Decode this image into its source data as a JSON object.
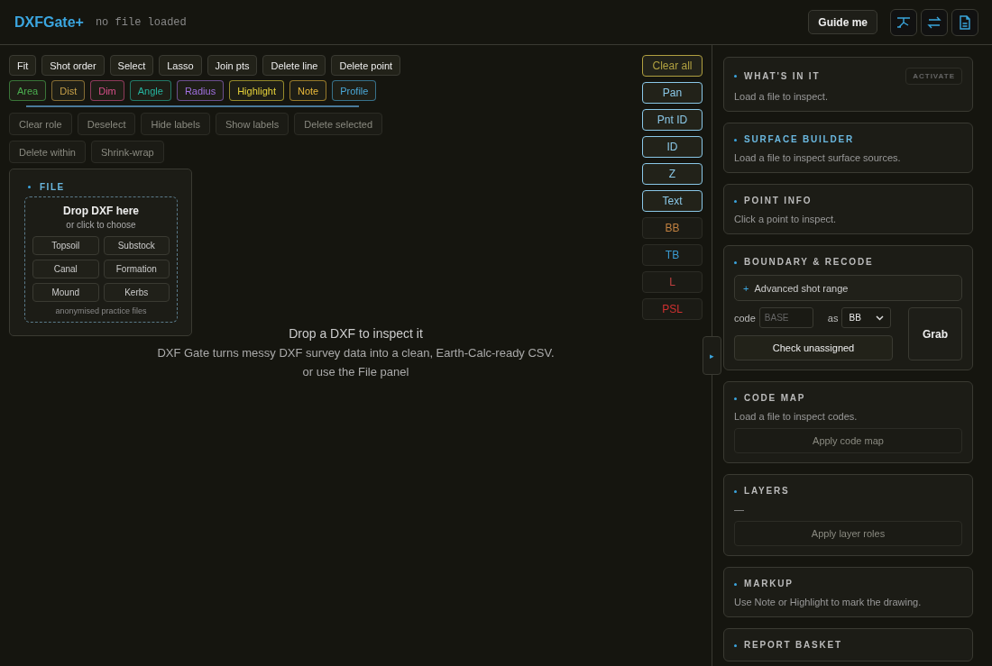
{
  "header": {
    "title": "DXFGate+",
    "file_status": "no file loaded",
    "guide_button": "Guide me"
  },
  "toolbar": {
    "tools": [
      {
        "label": "Fit"
      },
      {
        "label": "Shot order"
      },
      {
        "label": "Select"
      },
      {
        "label": "Lasso"
      },
      {
        "label": "Join pts"
      },
      {
        "label": "Delete line"
      },
      {
        "label": "Delete point"
      }
    ],
    "measure_tools": [
      {
        "label": "Area",
        "color": "#4caf50"
      },
      {
        "label": "Dist",
        "color": "#c9a24a"
      },
      {
        "label": "Dim",
        "color": "#d94f8a"
      },
      {
        "label": "Angle",
        "color": "#26b5a0"
      },
      {
        "label": "Radius",
        "color": "#a070e0"
      },
      {
        "label": "Highlight",
        "color": "#e6d23a"
      },
      {
        "label": "Note",
        "color": "#e8b83a"
      },
      {
        "label": "Profile",
        "color": "#4aa8d8"
      }
    ],
    "selection_tools": [
      {
        "label": "Clear role",
        "disabled": true
      },
      {
        "label": "Deselect",
        "disabled": true
      },
      {
        "label": "Hide labels",
        "disabled": true
      },
      {
        "label": "Show labels",
        "disabled": true
      },
      {
        "label": "Delete selected",
        "disabled": true
      },
      {
        "label": "Delete within",
        "disabled": true
      },
      {
        "label": "Shrink-wrap",
        "disabled": true
      }
    ]
  },
  "file_panel": {
    "title": "FILE",
    "drop_title": "Drop DXF here",
    "drop_hint": "or click to choose",
    "samples": [
      "Topsoil",
      "Substock",
      "Canal",
      "Formation",
      "Mound",
      "Kerbs"
    ],
    "samples_note": "anonymised practice files"
  },
  "canvas": {
    "headline": "Drop a DXF to inspect it",
    "description": "DXF Gate turns messy DXF survey data into a clean, Earth-Calc-ready CSV.",
    "hint": "or use the File panel"
  },
  "side_buttons": [
    {
      "label": "Clear all",
      "color": "#b0a040",
      "disabled": false
    },
    {
      "label": "Pan",
      "color": "#8ac8e8",
      "disabled": false
    },
    {
      "label": "Pnt ID",
      "color": "#8ac8e8",
      "disabled": false
    },
    {
      "label": "ID",
      "color": "#8ac8e8",
      "disabled": false
    },
    {
      "label": "Z",
      "color": "#8ac8e8",
      "disabled": false
    },
    {
      "label": "Text",
      "color": "#8ac8e8",
      "disabled": false
    },
    {
      "label": "BB",
      "color": "#c08040",
      "disabled": true
    },
    {
      "label": "TB",
      "color": "#3a9ad0",
      "disabled": true
    },
    {
      "label": "L",
      "color": "#c04040",
      "disabled": true
    },
    {
      "label": "PSL",
      "color": "#d03030",
      "disabled": true
    }
  ],
  "panel_toggle": "▸",
  "sections": [
    {
      "kind": "text",
      "title": "WHAT'S IN IT",
      "highlighted": false,
      "badge": "ACTIVATE",
      "text": "Load a file to inspect."
    },
    {
      "kind": "text",
      "title": "SURFACE BUILDER",
      "highlighted": true,
      "text": "Load a file to inspect surface sources."
    },
    {
      "kind": "text",
      "title": "POINT INFO",
      "highlighted": false,
      "text": "Click a point to inspect."
    },
    {
      "kind": "boundary",
      "title": "BOUNDARY & RECODE",
      "highlighted": false,
      "expander_icon": "+",
      "expander": "Advanced shot range",
      "code_label": "code",
      "code_placeholder": "BASE",
      "as_label": "as",
      "as_value": "BB",
      "check_button": "Check unassigned",
      "grab_button": "Grab"
    },
    {
      "kind": "text_button",
      "title": "CODE MAP",
      "highlighted": false,
      "text": "Load a file to inspect codes.",
      "button": "Apply code map"
    },
    {
      "kind": "text_button",
      "title": "LAYERS",
      "highlighted": false,
      "text": "—",
      "button": "Apply layer roles"
    },
    {
      "kind": "text",
      "title": "MARKUP",
      "highlighted": false,
      "text": "Use Note or Highlight to mark the drawing."
    },
    {
      "kind": "title",
      "title": "REPORT BASKET",
      "highlighted": false
    }
  ]
}
